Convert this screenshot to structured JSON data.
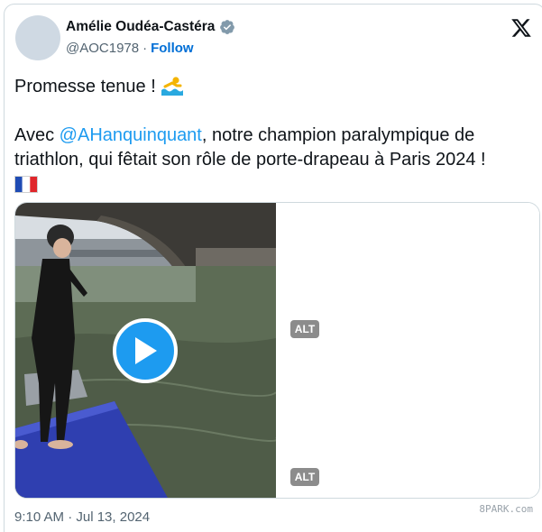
{
  "author": {
    "name": "Amélie Oudéa-Castéra",
    "handle": "@AOC1978",
    "separator": "·",
    "follow_label": "Follow"
  },
  "tweet": {
    "line1": "Promesse tenue ! ",
    "line2_prefix": "Avec ",
    "mention": "@AHanquinquant",
    "line2_suffix": ", notre champion paralympique de triathlon, qui fêtait son rôle de porte-drapeau à Paris 2024 !"
  },
  "media": {
    "alt_badge_1": "ALT",
    "alt_badge_2": "ALT"
  },
  "timestamp": "9:10 AM · Jul 13, 2024",
  "watermark": "8PARK.com",
  "icons": {
    "platform": "x-logo-icon",
    "verified": "verified-badge-icon",
    "swimmer": "swimmer-emoji",
    "flag": "france-flag-emoji",
    "play": "play-icon"
  },
  "colors": {
    "link": "#1d9bf0",
    "follow": "#006fd6",
    "text": "#0f1419",
    "secondary": "#536471",
    "play": "#1d9bf0"
  }
}
